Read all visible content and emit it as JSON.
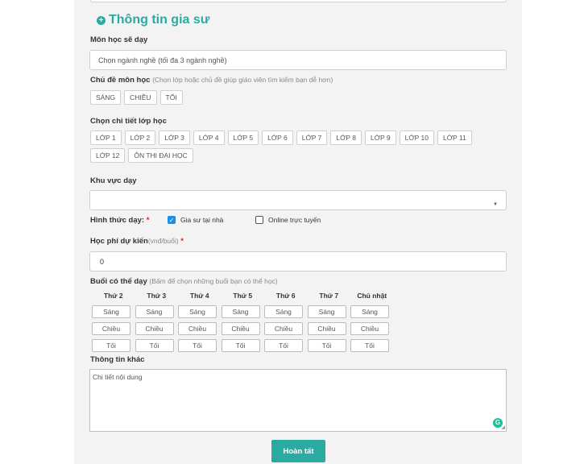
{
  "section_title": "Thông tin gia sư",
  "subject": {
    "label": "Môn học sẽ dạy",
    "placeholder": "Chọn ngành nghề (tối đa 3 ngành nghề)"
  },
  "topic": {
    "label": "Chủ đề môn học",
    "hint": "(Chọn lớp hoặc chủ đề giúp giáo viên tìm kiếm bạn dễ hơn)",
    "chips": [
      "SÁNG",
      "CHIỀU",
      "TỐI"
    ]
  },
  "grade": {
    "label": "Chọn chi tiết lớp học",
    "chips": [
      "LỚP 1",
      "LỚP 2",
      "LỚP 3",
      "LỚP 4",
      "LỚP 5",
      "LỚP 6",
      "LỚP 7",
      "LỚP 8",
      "LỚP 9",
      "LỚP 10",
      "LỚP 11",
      "LỚP 12",
      "ÔN THI ĐẠI HỌC"
    ]
  },
  "area": {
    "label": "Khu vực dạy",
    "value": ""
  },
  "mode": {
    "label": "Hình thức dạy:",
    "required": "*",
    "options": [
      {
        "label": "Gia sư tại nhà",
        "checked": true
      },
      {
        "label": "Online trực tuyến",
        "checked": false
      }
    ]
  },
  "fee": {
    "label": "Học phí dự kiến",
    "unit": "(vnđ/buổi)",
    "required": "*",
    "value": "0"
  },
  "schedule": {
    "label": "Buổi có thể dạy",
    "hint": "(Bấm để chọn những buổi bạn có thể học)",
    "days": [
      "Thứ 2",
      "Thứ 3",
      "Thứ 4",
      "Thứ 5",
      "Thứ 6",
      "Thứ 7",
      "Chủ nhật"
    ],
    "slots": [
      "Sáng",
      "Chiều",
      "Tối"
    ]
  },
  "other": {
    "label": "Thông tin khác",
    "placeholder": "Chi tiết nội dung"
  },
  "submit_label": "Hoàn tất",
  "colors": {
    "accent": "#2baaa1",
    "required": "#d9251c",
    "checkbox": "#1a8fe3"
  }
}
